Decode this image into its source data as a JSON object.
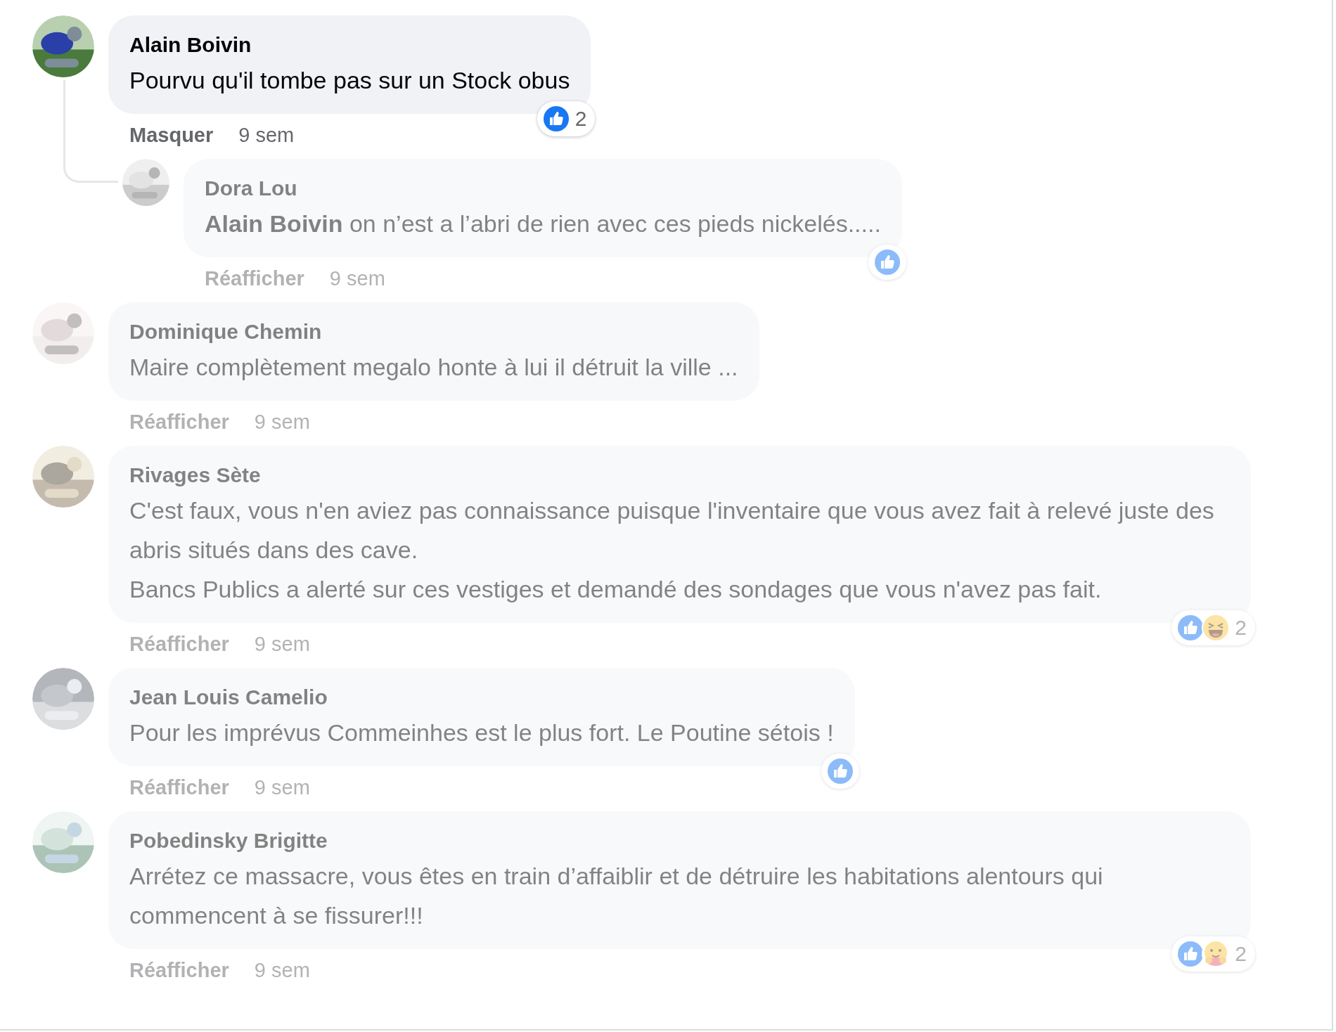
{
  "comments": [
    {
      "author": "Alain Boivin",
      "text": "Pourvu qu'il tombe pas sur un Stock obus",
      "hidden": false,
      "action": "Masquer",
      "time": "9 sem",
      "reactions": [
        {
          "kind": "like"
        }
      ],
      "reaction_count": "2",
      "children": [
        {
          "author": "Dora Lou",
          "text": "**Alain Boivin** on n’est a l’abri de rien avec ces pieds nickelés.....",
          "hidden": true,
          "action": "Réafficher",
          "time": "9 sem",
          "reactions": [
            {
              "kind": "like"
            }
          ]
        }
      ]
    },
    {
      "author": "Dominique Chemin",
      "text": "Maire complètement megalo honte à lui il détruit la ville ...",
      "hidden": true,
      "action": "Réafficher",
      "time": "9 sem"
    },
    {
      "author": "Rivages Sète",
      "text": "C'est faux, vous n'en aviez pas connaissance puisque l'inventaire que vous avez fait à relevé juste des abris situés dans des cave.\nBancs Publics a alerté sur ces vestiges et demandé des sondages que vous n'avez pas fait.",
      "hidden": true,
      "action": "Réafficher",
      "time": "9 sem",
      "reactions": [
        {
          "kind": "like"
        },
        {
          "kind": "haha"
        }
      ],
      "reaction_count": "2"
    },
    {
      "author": "Jean Louis Camelio",
      "text": "Pour les imprévus Commeinhes est le plus fort. Le Poutine sétois !",
      "hidden": true,
      "action": "Réafficher",
      "time": "9 sem",
      "reactions": [
        {
          "kind": "like"
        }
      ]
    },
    {
      "author": "Pobedinsky Brigitte",
      "text": "Arrétez ce massacre, vous êtes en train d’affaiblir et de détruire les habitations alentours qui commencent à se fissurer!!!",
      "hidden": true,
      "action": "Réafficher",
      "time": "9 sem",
      "reactions": [
        {
          "kind": "like"
        },
        {
          "kind": "care"
        }
      ],
      "reaction_count": "2"
    }
  ]
}
